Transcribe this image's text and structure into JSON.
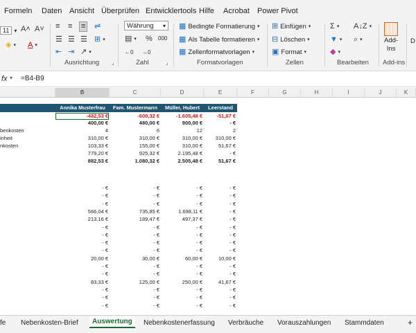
{
  "menu": [
    "Formeln",
    "Daten",
    "Ansicht",
    "Überprüfen",
    "Entwicklertools",
    "Hilfe",
    "Acrobat",
    "Power Pivot"
  ],
  "ribbon": {
    "font_size": "11",
    "number_format": "Währung",
    "percent": "%",
    "thousands": "000",
    "groups": {
      "alignment": "Ausrichtung",
      "number": "Zahl",
      "styles": "Formatvorlagen",
      "cells": "Zellen",
      "editing": "Bearbeiten",
      "addins": "Add-ins"
    },
    "styles_items": [
      "Bedingte Formatierung",
      "Als Tabelle formatieren",
      "Zellenformatvorlagen"
    ],
    "cells_items": [
      "Einfügen",
      "Löschen",
      "Format"
    ],
    "addins_button_line1": "Add-",
    "addins_button_line2": "Ins",
    "cut_off_letter": "D"
  },
  "formula_bar": {
    "fx": "fx",
    "formula": "=B4-B9"
  },
  "columns": [
    "B",
    "C",
    "D",
    "E",
    "F",
    "G",
    "H",
    "I",
    "J",
    "K"
  ],
  "sheet": {
    "headers": [
      "Annika Musterfrau",
      "Fam. Mustermann",
      "Müller, Hubert",
      "Leerstand"
    ],
    "row_labels": [
      "",
      "",
      "benkosten",
      "inheit",
      "nkosten",
      "",
      "",
      "",
      "",
      ""
    ],
    "top_rows": [
      [
        "-482,53 €",
        "-600,32 €",
        "-1.605,48 €",
        "-51,67 €"
      ],
      [
        "400,00 €",
        "480,00 €",
        "900,00 €",
        "-    €"
      ],
      [
        "4",
        "6",
        "12",
        "2"
      ],
      [
        "310,00 €",
        "310,00 €",
        "310,00 €",
        "310,00 €"
      ],
      [
        "103,33 €",
        "155,00 €",
        "310,00 €",
        "51,67 €"
      ],
      [
        "779,20 €",
        "925,32 €",
        "2.195,48 €",
        "-    €"
      ],
      [
        "882,53 €",
        "1.080,32 €",
        "2.505,48 €",
        "51,67 €"
      ]
    ],
    "lower_rows": [
      [
        "-    €",
        "-    €",
        "-    €",
        "-    €"
      ],
      [
        "-    €",
        "-    €",
        "-    €",
        "-    €"
      ],
      [
        "-    €",
        "-    €",
        "-    €",
        "-    €"
      ],
      [
        "566,04 €",
        "735,85 €",
        "1.698,11 €",
        "-    €"
      ],
      [
        "213,16 €",
        "189,47 €",
        "497,37 €",
        "-    €"
      ],
      [
        "-    €",
        "-    €",
        "-    €",
        "-    €"
      ],
      [
        "-    €",
        "-    €",
        "-    €",
        "-    €"
      ],
      [
        "-    €",
        "-    €",
        "-    €",
        "-    €"
      ],
      [
        "-    €",
        "-    €",
        "-    €",
        "-    €"
      ],
      [
        "20,00 €",
        "30,00 €",
        "60,00 €",
        "10,00 €"
      ],
      [
        "-    €",
        "-    €",
        "-    €",
        "-    €"
      ],
      [
        "-    €",
        "-    €",
        "-    €",
        "-    €"
      ],
      [
        "83,33 €",
        "125,00 €",
        "250,00 €",
        "41,67 €"
      ],
      [
        "-    €",
        "-    €",
        "-    €",
        "-    €"
      ],
      [
        "-    €",
        "-    €",
        "-    €",
        "-    €"
      ],
      [
        "-    €",
        "-    €",
        "-    €",
        "-    €"
      ]
    ]
  },
  "tabs": [
    "fe",
    "Nebenkosten-Brief",
    "Auswertung",
    "Nebenkostenerfassung",
    "Verbräuche",
    "Vorauszahlungen",
    "Stammdaten"
  ],
  "active_tab": "Auswertung",
  "add_sheet": "+"
}
